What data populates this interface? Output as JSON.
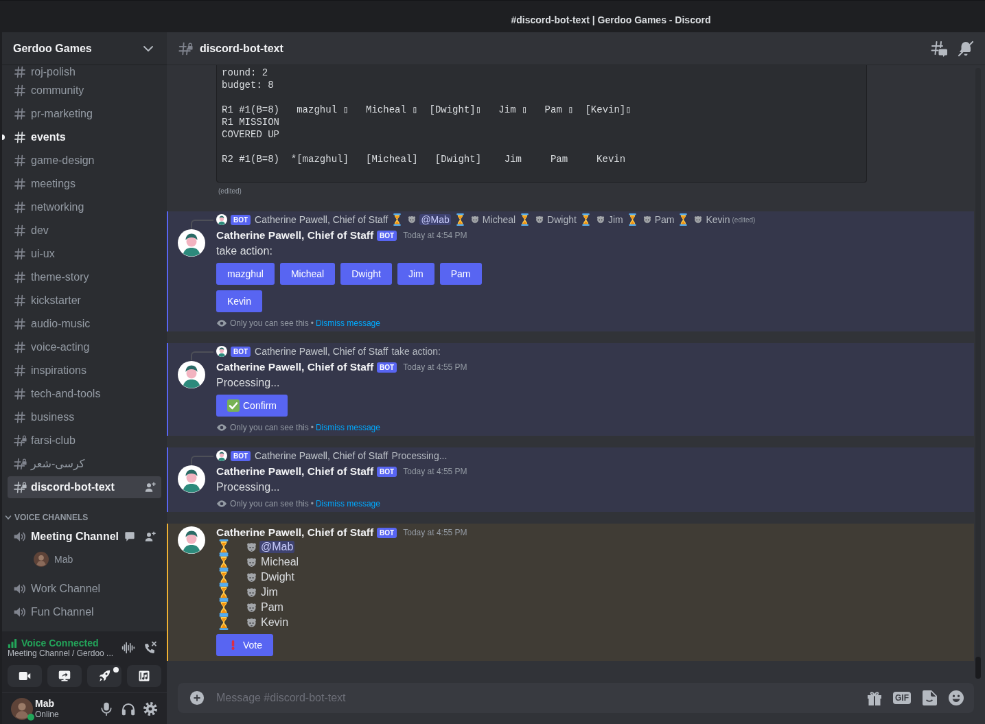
{
  "window": {
    "title": "#discord-bot-text | Gerdoo Games - Discord"
  },
  "server": {
    "name": "Gerdoo Games"
  },
  "text_channels": [
    {
      "name": "roj-polish",
      "locked": false,
      "unread": false,
      "selected": false
    },
    {
      "name": "community",
      "locked": false,
      "unread": false,
      "selected": false
    },
    {
      "name": "pr-marketing",
      "locked": false,
      "unread": false,
      "selected": false
    },
    {
      "name": "events",
      "locked": false,
      "unread": true,
      "selected": false
    },
    {
      "name": "game-design",
      "locked": false,
      "unread": false,
      "selected": false
    },
    {
      "name": "meetings",
      "locked": false,
      "unread": false,
      "selected": false
    },
    {
      "name": "networking",
      "locked": false,
      "unread": false,
      "selected": false
    },
    {
      "name": "dev",
      "locked": false,
      "unread": false,
      "selected": false
    },
    {
      "name": "ui-ux",
      "locked": false,
      "unread": false,
      "selected": false
    },
    {
      "name": "theme-story",
      "locked": false,
      "unread": false,
      "selected": false
    },
    {
      "name": "kickstarter",
      "locked": false,
      "unread": false,
      "selected": false
    },
    {
      "name": "audio-music",
      "locked": false,
      "unread": false,
      "selected": false
    },
    {
      "name": "voice-acting",
      "locked": false,
      "unread": false,
      "selected": false
    },
    {
      "name": "inspirations",
      "locked": false,
      "unread": false,
      "selected": false
    },
    {
      "name": "tech-and-tools",
      "locked": false,
      "unread": false,
      "selected": false
    },
    {
      "name": "business",
      "locked": false,
      "unread": false,
      "selected": false
    },
    {
      "name": "farsi-club",
      "locked": true,
      "unread": false,
      "selected": false
    },
    {
      "name": "کرسی-شعر",
      "locked": true,
      "unread": false,
      "selected": false
    },
    {
      "name": "discord-bot-text",
      "locked": true,
      "unread": false,
      "selected": true
    }
  ],
  "voice_category": {
    "label": "VOICE CHANNELS",
    "expanded": true
  },
  "voice_channels": [
    {
      "name": "Meeting Channel",
      "active": true,
      "members": [
        {
          "name": "Mab"
        }
      ]
    },
    {
      "name": "Work Channel",
      "active": false
    },
    {
      "name": "Fun Channel",
      "active": false
    }
  ],
  "voice_panel": {
    "status": "Voice Connected",
    "location": "Meeting Channel / Gerdoo ...",
    "activity_dot": true
  },
  "user_panel": {
    "name": "Mab",
    "status": "Online",
    "online": true
  },
  "channel_header": {
    "name": "discord-bot-text",
    "locked": true
  },
  "code_message": {
    "paragraphs": [
      [
        "round: 2",
        "budget: 8"
      ],
      [
        "R1 #1(B=8)   mazghul ▯   Micheal ▯  [Dwight]▯   Jim ▯   Pam ▯  [Kevin]▯",
        "R1 MISSION",
        "COVERED UP"
      ],
      [
        "R2 #1(B=8)  *[mazghul]   [Micheal]   [Dwight]    Jim     Pam     Kevin"
      ]
    ],
    "edited": "(edited)"
  },
  "messages": [
    {
      "ephemeral": true,
      "mentioned": false,
      "reply": {
        "bot_tag": "BOT",
        "author": "Catherine Pawell, Chief of Staff",
        "votes": [
          {
            "name": "@Mab",
            "mention": true
          },
          {
            "name": "Micheal",
            "mention": false
          },
          {
            "name": "Dwight",
            "mention": false
          },
          {
            "name": "Jim",
            "mention": false
          },
          {
            "name": "Pam",
            "mention": false
          },
          {
            "name": "Kevin",
            "mention": false
          }
        ],
        "edited": "(edited)"
      },
      "author": "Catherine Pawell, Chief of Staff",
      "bot_tag": "BOT",
      "time": "Today at 4:54 PM",
      "text": "take action:",
      "button_rows": [
        [
          {
            "label": "mazghul",
            "kind": "plain"
          },
          {
            "label": "Micheal",
            "kind": "plain"
          },
          {
            "label": "Dwight",
            "kind": "plain"
          },
          {
            "label": "Jim",
            "kind": "plain"
          },
          {
            "label": "Pam",
            "kind": "plain"
          }
        ],
        [
          {
            "label": "Kevin",
            "kind": "plain"
          }
        ]
      ],
      "note": "Only you can see this",
      "separator": "•",
      "dismiss": "Dismiss message"
    },
    {
      "ephemeral": true,
      "mentioned": false,
      "reply": {
        "bot_tag": "BOT",
        "author": "Catherine Pawell, Chief of Staff",
        "text": "take action:"
      },
      "author": "Catherine Pawell, Chief of Staff",
      "bot_tag": "BOT",
      "time": "Today at 4:55 PM",
      "text": "Processing...",
      "button_rows": [
        [
          {
            "label": "Confirm",
            "kind": "confirm"
          }
        ]
      ],
      "note": "Only you can see this",
      "separator": "•",
      "dismiss": "Dismiss message"
    },
    {
      "ephemeral": true,
      "mentioned": false,
      "reply": {
        "bot_tag": "BOT",
        "author": "Catherine Pawell, Chief of Staff",
        "text": "Processing..."
      },
      "author": "Catherine Pawell, Chief of Staff",
      "bot_tag": "BOT",
      "time": "Today at 4:55 PM",
      "text": "Processing...",
      "note": "Only you can see this",
      "separator": "•",
      "dismiss": "Dismiss message"
    },
    {
      "ephemeral": false,
      "mentioned": true,
      "author": "Catherine Pawell, Chief of Staff",
      "bot_tag": "BOT",
      "time": "Today at 4:55 PM",
      "votes": [
        {
          "name": "@Mab",
          "mention": true
        },
        {
          "name": "Micheal",
          "mention": false
        },
        {
          "name": "Dwight",
          "mention": false
        },
        {
          "name": "Jim",
          "mention": false
        },
        {
          "name": "Pam",
          "mention": false
        },
        {
          "name": "Kevin",
          "mention": false
        }
      ],
      "button_rows": [
        [
          {
            "label": "Vote",
            "kind": "vote"
          }
        ]
      ]
    }
  ],
  "composer": {
    "placeholder": "Message #discord-bot-text",
    "gif_label": "GIF"
  }
}
